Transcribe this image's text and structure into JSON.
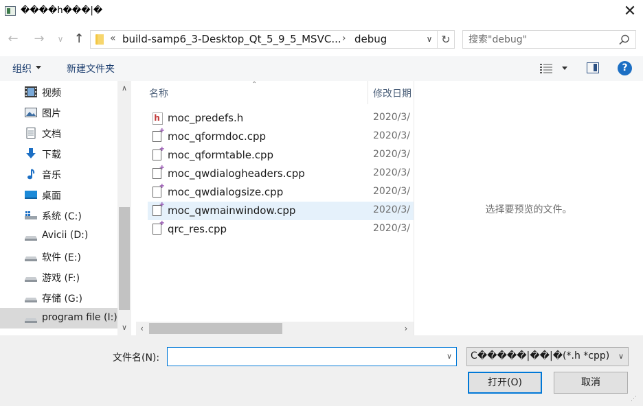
{
  "window": {
    "title": "����h���|�",
    "close_glyph": "✕"
  },
  "address": {
    "separator": "«",
    "crumbs": [
      "build-samp6_3-Desktop_Qt_5_9_5_MSVC...",
      "debug"
    ],
    "crumb_sep": "›"
  },
  "search": {
    "placeholder": "搜索\"debug\""
  },
  "toolbar": {
    "organize": "组织",
    "new_folder": "新建文件夹"
  },
  "nav": {
    "items": [
      {
        "label": "视频",
        "icon": "video-icon"
      },
      {
        "label": "图片",
        "icon": "pictures-icon"
      },
      {
        "label": "文档",
        "icon": "documents-icon"
      },
      {
        "label": "下载",
        "icon": "downloads-icon"
      },
      {
        "label": "音乐",
        "icon": "music-icon"
      },
      {
        "label": "桌面",
        "icon": "desktop-icon"
      },
      {
        "label": "系统 (C:)",
        "icon": "system-drive-icon"
      },
      {
        "label": "Avicii (D:)",
        "icon": "drive-icon"
      },
      {
        "label": "软件 (E:)",
        "icon": "drive-icon"
      },
      {
        "label": "游戏 (F:)",
        "icon": "drive-icon"
      },
      {
        "label": "存储 (G:)",
        "icon": "drive-icon"
      },
      {
        "label": "program file (I:)",
        "icon": "drive-icon"
      }
    ]
  },
  "files": {
    "columns": {
      "name": "名称",
      "date": "修改日期"
    },
    "rows": [
      {
        "name": "moc_predefs.h",
        "date": "2020/3/",
        "type": "header"
      },
      {
        "name": "moc_qformdoc.cpp",
        "date": "2020/3/",
        "type": "cpp"
      },
      {
        "name": "moc_qformtable.cpp",
        "date": "2020/3/",
        "type": "cpp"
      },
      {
        "name": "moc_qwdialogheaders.cpp",
        "date": "2020/3/",
        "type": "cpp"
      },
      {
        "name": "moc_qwdialogsize.cpp",
        "date": "2020/3/",
        "type": "cpp"
      },
      {
        "name": "moc_qwmainwindow.cpp",
        "date": "2020/3/",
        "type": "cpp"
      },
      {
        "name": "qrc_res.cpp",
        "date": "2020/3/",
        "type": "cpp"
      }
    ]
  },
  "preview": {
    "empty_text": "选择要预览的文件。"
  },
  "bottom": {
    "filename_label": "文件名(N):",
    "filename_value": "",
    "filter": "C�����|��|�(*.h *cpp)",
    "open": "打开(O)",
    "cancel": "取消"
  },
  "colors": {
    "accent": "#0078d7",
    "selection": "#cce1f5",
    "hover_row": "#e5f1fb",
    "link_text": "#1a3c6e"
  }
}
